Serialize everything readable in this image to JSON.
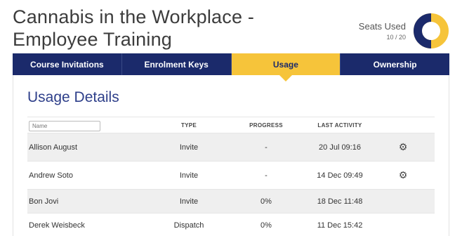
{
  "header": {
    "title_line1": "Cannabis in the Workplace -",
    "title_line2": "Employee Training"
  },
  "seats": {
    "label": "Seats Used",
    "count": "10 / 20",
    "used": 10,
    "total": 20,
    "used_color": "#1b2a6b",
    "free_color": "#f6c43a"
  },
  "tabs": [
    {
      "label": "Course Invitations",
      "active": false
    },
    {
      "label": "Enrolment Keys",
      "active": false
    },
    {
      "label": "Usage",
      "active": true
    },
    {
      "label": "Ownership",
      "active": false
    }
  ],
  "section": {
    "title": "Usage Details"
  },
  "table": {
    "name_placeholder": "Name",
    "headers": {
      "type": "TYPE",
      "progress": "PROGRESS",
      "last_activity": "LAST ACTIVITY"
    },
    "rows": [
      {
        "name": "Allison August",
        "type": "Invite",
        "progress": "-",
        "last_activity": "20 Jul 09:16",
        "gear": true
      },
      {
        "name": "Andrew Soto",
        "type": "Invite",
        "progress": "-",
        "last_activity": "14 Dec 09:49",
        "gear": true
      },
      {
        "name": "Bon Jovi",
        "type": "Invite",
        "progress": "0%",
        "last_activity": "18 Dec 11:48",
        "gear": false
      },
      {
        "name": "Derek Weisbeck",
        "type": "Dispatch",
        "progress": "0%",
        "last_activity": "11 Dec 15:42",
        "gear": false
      }
    ]
  },
  "colors": {
    "brand_navy": "#1b2a6b",
    "brand_yellow": "#f6c43a"
  }
}
